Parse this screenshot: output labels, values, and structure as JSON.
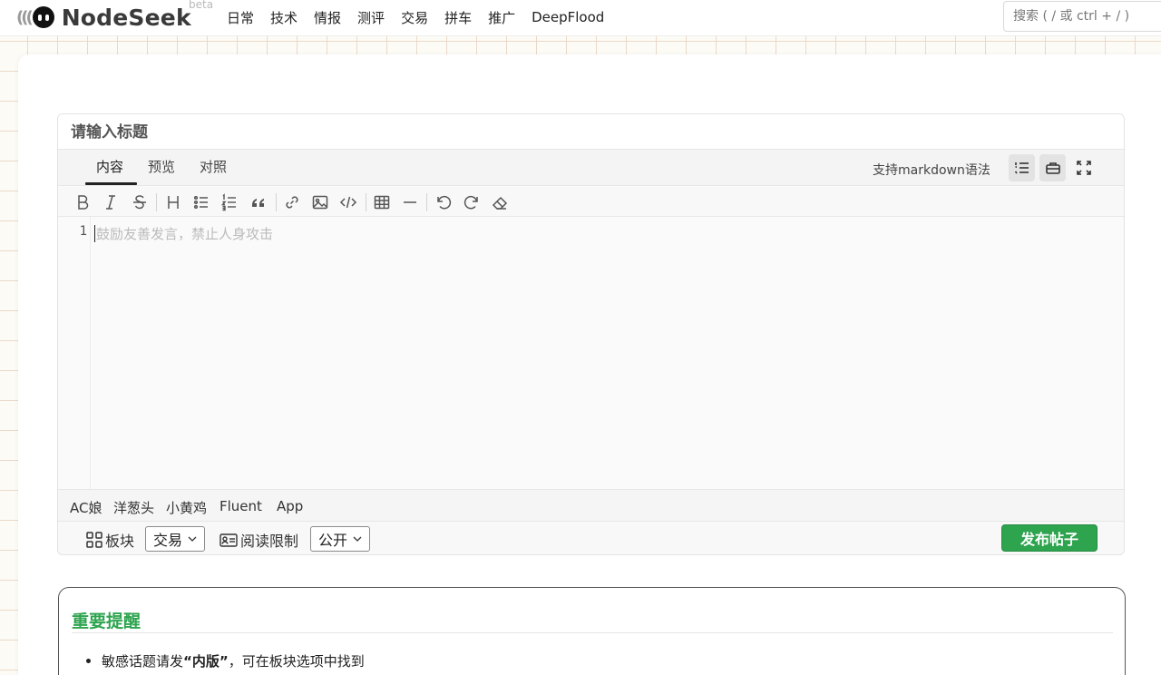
{
  "header": {
    "logo_text": "NodeSeek",
    "beta_label": "beta",
    "nav": [
      "日常",
      "技术",
      "情报",
      "测评",
      "交易",
      "拼车",
      "推广",
      "DeepFlood"
    ],
    "search_placeholder": "搜索 ( / 或 ctrl + / )"
  },
  "editor": {
    "title_placeholder": "请输入标题",
    "tabs": [
      "内容",
      "预览",
      "对照"
    ],
    "active_tab": "内容",
    "markdown_hint": "支持markdown语法",
    "toolbar_icons": [
      "bold-icon",
      "italic-icon",
      "strikethrough-icon",
      "heading-icon",
      "bullet-list-icon",
      "ordered-list-icon",
      "quote-icon",
      "link-icon",
      "image-icon",
      "code-icon",
      "table-icon",
      "horizontal-rule-icon",
      "undo-icon",
      "redo-icon",
      "eraser-icon"
    ],
    "line_number": "1",
    "body_placeholder": "鼓励友善发言，禁止人身攻击",
    "emoji_sets": [
      "AC娘",
      "洋葱头",
      "小黄鸡",
      "Fluent",
      "App"
    ],
    "board_label": "板块",
    "board_value": "交易",
    "read_limit_label": "阅读限制",
    "read_limit_value": "公开",
    "publish_label": "发布帖子"
  },
  "notice": {
    "title": "重要提醒",
    "item_prefix": "敏感话题请发",
    "item_bold": "“内版”",
    "item_suffix": "，可在板块选项中找到"
  },
  "colors": {
    "accent": "#2ea44f",
    "grid": "#ead9c9",
    "page_bg": "#fdfbf6"
  }
}
